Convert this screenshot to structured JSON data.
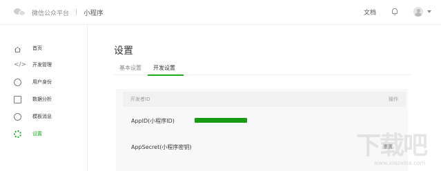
{
  "topbar": {
    "brand_name": "微信公众平台",
    "separator": "|",
    "product": "小程序",
    "docs_label": "文档"
  },
  "sidebar": {
    "items": [
      {
        "label": "首页",
        "icon": "home-icon"
      },
      {
        "label": "开发管理",
        "icon": "code-icon"
      },
      {
        "label": "用户身份",
        "icon": "user-icon"
      },
      {
        "label": "数据分析",
        "icon": "data-icon"
      },
      {
        "label": "模板消息",
        "icon": "message-icon"
      },
      {
        "label": "设置",
        "icon": "gear-icon",
        "active": true
      }
    ]
  },
  "main": {
    "title": "设置",
    "tabs": [
      {
        "label": "基本设置"
      },
      {
        "label": "开发设置",
        "active": true
      }
    ],
    "table": {
      "header_left": "开发者ID",
      "header_right": "操作",
      "rows": [
        {
          "label": "AppID(小程序ID)"
        },
        {
          "label": "AppSecret(小程序密钥)",
          "action": "重置"
        }
      ]
    }
  },
  "watermark": {
    "main": "下载吧",
    "sub": "www.xiazaiba.com"
  },
  "colors": {
    "accent": "#1aad19",
    "redaction": "#179b17"
  }
}
